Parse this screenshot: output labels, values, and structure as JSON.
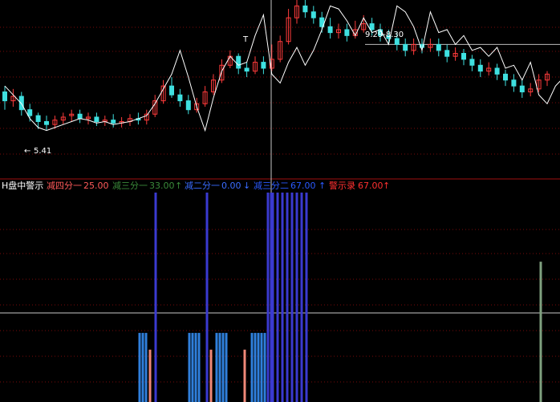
{
  "colors": {
    "background": "#000000",
    "candle_up": "#ff3b3b",
    "candle_down": "#3fe0e0",
    "price_line": "#ffffff",
    "grid": "#7a0a0a",
    "crosshair": "#c8c8c8",
    "divider": "#a01010",
    "bar_a": "#2f7fdc",
    "bar_b": "#3a3ad0",
    "bar_c": "#f08878",
    "bar_d": "#7fa07f"
  },
  "indicator": {
    "name": "H盘中警示",
    "items": [
      {
        "label": "减四分一",
        "value": "25.00",
        "arrow": "",
        "color": "#ff5a5a"
      },
      {
        "label": "减三分一",
        "value": "33.00",
        "arrow": "↑",
        "color": "#3a8a3a"
      },
      {
        "label": "减二分一",
        "value": "0.00",
        "arrow": "↓",
        "color": "#3a6cff"
      },
      {
        "label": "减三分二",
        "value": "67.00",
        "arrow": "↑",
        "color": "#2a5aff"
      },
      {
        "label": "警示录",
        "value": "67.00",
        "arrow": "↑",
        "color": "#ff3030"
      }
    ]
  },
  "annotations": {
    "low_label": "5.41",
    "low_arrow": "←",
    "peak_marker": "T",
    "range_label": "9.29-8.30"
  },
  "chart_data": [
    {
      "type": "candlestick",
      "title": "",
      "yrange": [
        3.9,
        9.8
      ],
      "candles": [
        {
          "o": 6.7,
          "c": 6.4,
          "h": 6.9,
          "l": 6.1
        },
        {
          "o": 6.4,
          "c": 6.55,
          "h": 6.8,
          "l": 6.2
        },
        {
          "o": 6.55,
          "c": 6.1,
          "h": 6.7,
          "l": 5.9
        },
        {
          "o": 6.1,
          "c": 5.9,
          "h": 6.3,
          "l": 5.7
        },
        {
          "o": 5.9,
          "c": 5.7,
          "h": 6.0,
          "l": 5.45
        },
        {
          "o": 5.7,
          "c": 5.6,
          "h": 5.9,
          "l": 5.41
        },
        {
          "o": 5.6,
          "c": 5.75,
          "h": 5.9,
          "l": 5.45
        },
        {
          "o": 5.75,
          "c": 5.85,
          "h": 6.0,
          "l": 5.6
        },
        {
          "o": 5.9,
          "c": 5.95,
          "h": 6.1,
          "l": 5.7
        },
        {
          "o": 5.95,
          "c": 5.8,
          "h": 6.1,
          "l": 5.65
        },
        {
          "o": 5.8,
          "c": 5.85,
          "h": 6.0,
          "l": 5.6
        },
        {
          "o": 5.85,
          "c": 5.7,
          "h": 6.0,
          "l": 5.55
        },
        {
          "o": 5.7,
          "c": 5.75,
          "h": 5.9,
          "l": 5.55
        },
        {
          "o": 5.75,
          "c": 5.65,
          "h": 5.95,
          "l": 5.5
        },
        {
          "o": 5.65,
          "c": 5.7,
          "h": 5.85,
          "l": 5.5
        },
        {
          "o": 5.7,
          "c": 5.8,
          "h": 5.95,
          "l": 5.55
        },
        {
          "o": 5.8,
          "c": 5.75,
          "h": 6.0,
          "l": 5.6
        },
        {
          "o": 5.75,
          "c": 5.95,
          "h": 6.1,
          "l": 5.6
        },
        {
          "o": 5.95,
          "c": 6.4,
          "h": 6.6,
          "l": 5.85
        },
        {
          "o": 6.4,
          "c": 6.9,
          "h": 7.1,
          "l": 6.3
        },
        {
          "o": 6.9,
          "c": 6.6,
          "h": 7.2,
          "l": 6.5
        },
        {
          "o": 6.6,
          "c": 6.4,
          "h": 6.8,
          "l": 6.2
        },
        {
          "o": 6.4,
          "c": 6.1,
          "h": 6.6,
          "l": 5.95
        },
        {
          "o": 6.1,
          "c": 6.3,
          "h": 6.5,
          "l": 6.0
        },
        {
          "o": 6.3,
          "c": 6.7,
          "h": 6.9,
          "l": 6.2
        },
        {
          "o": 6.7,
          "c": 7.1,
          "h": 7.3,
          "l": 6.6
        },
        {
          "o": 7.1,
          "c": 7.6,
          "h": 7.8,
          "l": 7.0
        },
        {
          "o": 7.6,
          "c": 7.9,
          "h": 8.1,
          "l": 7.5
        },
        {
          "o": 7.9,
          "c": 7.5,
          "h": 8.0,
          "l": 7.3
        },
        {
          "o": 7.5,
          "c": 7.4,
          "h": 7.7,
          "l": 7.2
        },
        {
          "o": 7.4,
          "c": 7.7,
          "h": 7.9,
          "l": 7.3
        },
        {
          "o": 7.7,
          "c": 7.5,
          "h": 7.9,
          "l": 7.3
        },
        {
          "o": 7.5,
          "c": 7.8,
          "h": 8.3,
          "l": 7.4
        },
        {
          "o": 7.8,
          "c": 8.4,
          "h": 8.6,
          "l": 7.7
        },
        {
          "o": 8.4,
          "c": 9.2,
          "h": 9.5,
          "l": 8.3
        },
        {
          "o": 9.2,
          "c": 9.6,
          "h": 9.8,
          "l": 9.0
        },
        {
          "o": 9.6,
          "c": 9.4,
          "h": 9.8,
          "l": 9.2
        },
        {
          "o": 9.4,
          "c": 9.2,
          "h": 9.6,
          "l": 9.0
        },
        {
          "o": 9.2,
          "c": 8.9,
          "h": 9.4,
          "l": 8.7
        },
        {
          "o": 8.9,
          "c": 8.7,
          "h": 9.2,
          "l": 8.5
        },
        {
          "o": 8.7,
          "c": 8.8,
          "h": 9.0,
          "l": 8.5
        },
        {
          "o": 8.8,
          "c": 8.6,
          "h": 9.0,
          "l": 8.4
        },
        {
          "o": 8.6,
          "c": 8.8,
          "h": 9.1,
          "l": 8.5
        },
        {
          "o": 8.8,
          "c": 9.0,
          "h": 9.29,
          "l": 8.7
        },
        {
          "o": 9.0,
          "c": 8.8,
          "h": 9.2,
          "l": 8.6
        },
        {
          "o": 8.8,
          "c": 8.6,
          "h": 9.0,
          "l": 8.4
        },
        {
          "o": 8.6,
          "c": 8.5,
          "h": 8.8,
          "l": 8.3
        },
        {
          "o": 8.5,
          "c": 8.3,
          "h": 8.7,
          "l": 8.1
        },
        {
          "o": 8.3,
          "c": 8.1,
          "h": 8.5,
          "l": 7.9
        },
        {
          "o": 8.1,
          "c": 8.3,
          "h": 8.5,
          "l": 7.95
        },
        {
          "o": 8.3,
          "c": 8.2,
          "h": 8.5,
          "l": 8.0
        },
        {
          "o": 8.2,
          "c": 8.3,
          "h": 8.5,
          "l": 8.05
        },
        {
          "o": 8.3,
          "c": 8.1,
          "h": 8.5,
          "l": 7.9
        },
        {
          "o": 8.1,
          "c": 7.9,
          "h": 8.3,
          "l": 7.7
        },
        {
          "o": 7.9,
          "c": 8.0,
          "h": 8.2,
          "l": 7.75
        },
        {
          "o": 8.0,
          "c": 7.8,
          "h": 8.15,
          "l": 7.6
        },
        {
          "o": 7.8,
          "c": 7.6,
          "h": 7.95,
          "l": 7.4
        },
        {
          "o": 7.6,
          "c": 7.4,
          "h": 7.8,
          "l": 7.2
        },
        {
          "o": 7.4,
          "c": 7.5,
          "h": 7.7,
          "l": 7.25
        },
        {
          "o": 7.5,
          "c": 7.3,
          "h": 7.65,
          "l": 7.1
        },
        {
          "o": 7.3,
          "c": 7.1,
          "h": 7.45,
          "l": 6.9
        },
        {
          "o": 7.1,
          "c": 6.9,
          "h": 7.3,
          "l": 6.7
        },
        {
          "o": 6.9,
          "c": 6.7,
          "h": 7.1,
          "l": 6.5
        },
        {
          "o": 6.7,
          "c": 6.8,
          "h": 7.0,
          "l": 6.55
        },
        {
          "o": 6.8,
          "c": 7.1,
          "h": 7.3,
          "l": 6.7
        },
        {
          "o": 7.1,
          "c": 7.3,
          "h": 7.4,
          "l": 6.9
        }
      ],
      "line": [
        6.9,
        6.6,
        6.3,
        5.8,
        5.5,
        5.4,
        5.5,
        5.6,
        5.7,
        5.8,
        5.75,
        5.65,
        5.7,
        5.6,
        5.65,
        5.7,
        5.8,
        5.9,
        6.3,
        6.8,
        7.3,
        8.1,
        7.2,
        6.2,
        5.4,
        6.5,
        7.4,
        7.9,
        7.6,
        7.7,
        8.6,
        9.3,
        7.3,
        7.0,
        7.7,
        8.2,
        7.6,
        8.1,
        8.8,
        9.6,
        9.5,
        9.1,
        8.6,
        9.2,
        8.7,
        8.8,
        8.3,
        9.6,
        9.4,
        8.9,
        8.1,
        9.4,
        8.7,
        8.8,
        8.3,
        8.6,
        8.1,
        8.2,
        7.9,
        8.2,
        7.5,
        7.6,
        7.1,
        7.7,
        6.6,
        6.3,
        6.9,
        7.2,
        6.3,
        5.7
      ],
      "hline_value": 8.3
    },
    {
      "type": "bar",
      "title": "",
      "yrange": [
        0,
        100
      ],
      "baseline": 20,
      "series": [
        {
          "name": "减三分一",
          "values": [
            33,
            33,
            33,
            33,
            33,
            33,
            33,
            33,
            33,
            33,
            33,
            33,
            33,
            33,
            33,
            33
          ]
        },
        {
          "name": "减三分二",
          "values": [
            100,
            100,
            100,
            100,
            100,
            100,
            100,
            100,
            100,
            100,
            100,
            100
          ]
        },
        {
          "name": "减四分一",
          "values": [
            25,
            25,
            25
          ]
        },
        {
          "name": "警示录",
          "values": [
            67
          ]
        }
      ]
    }
  ]
}
